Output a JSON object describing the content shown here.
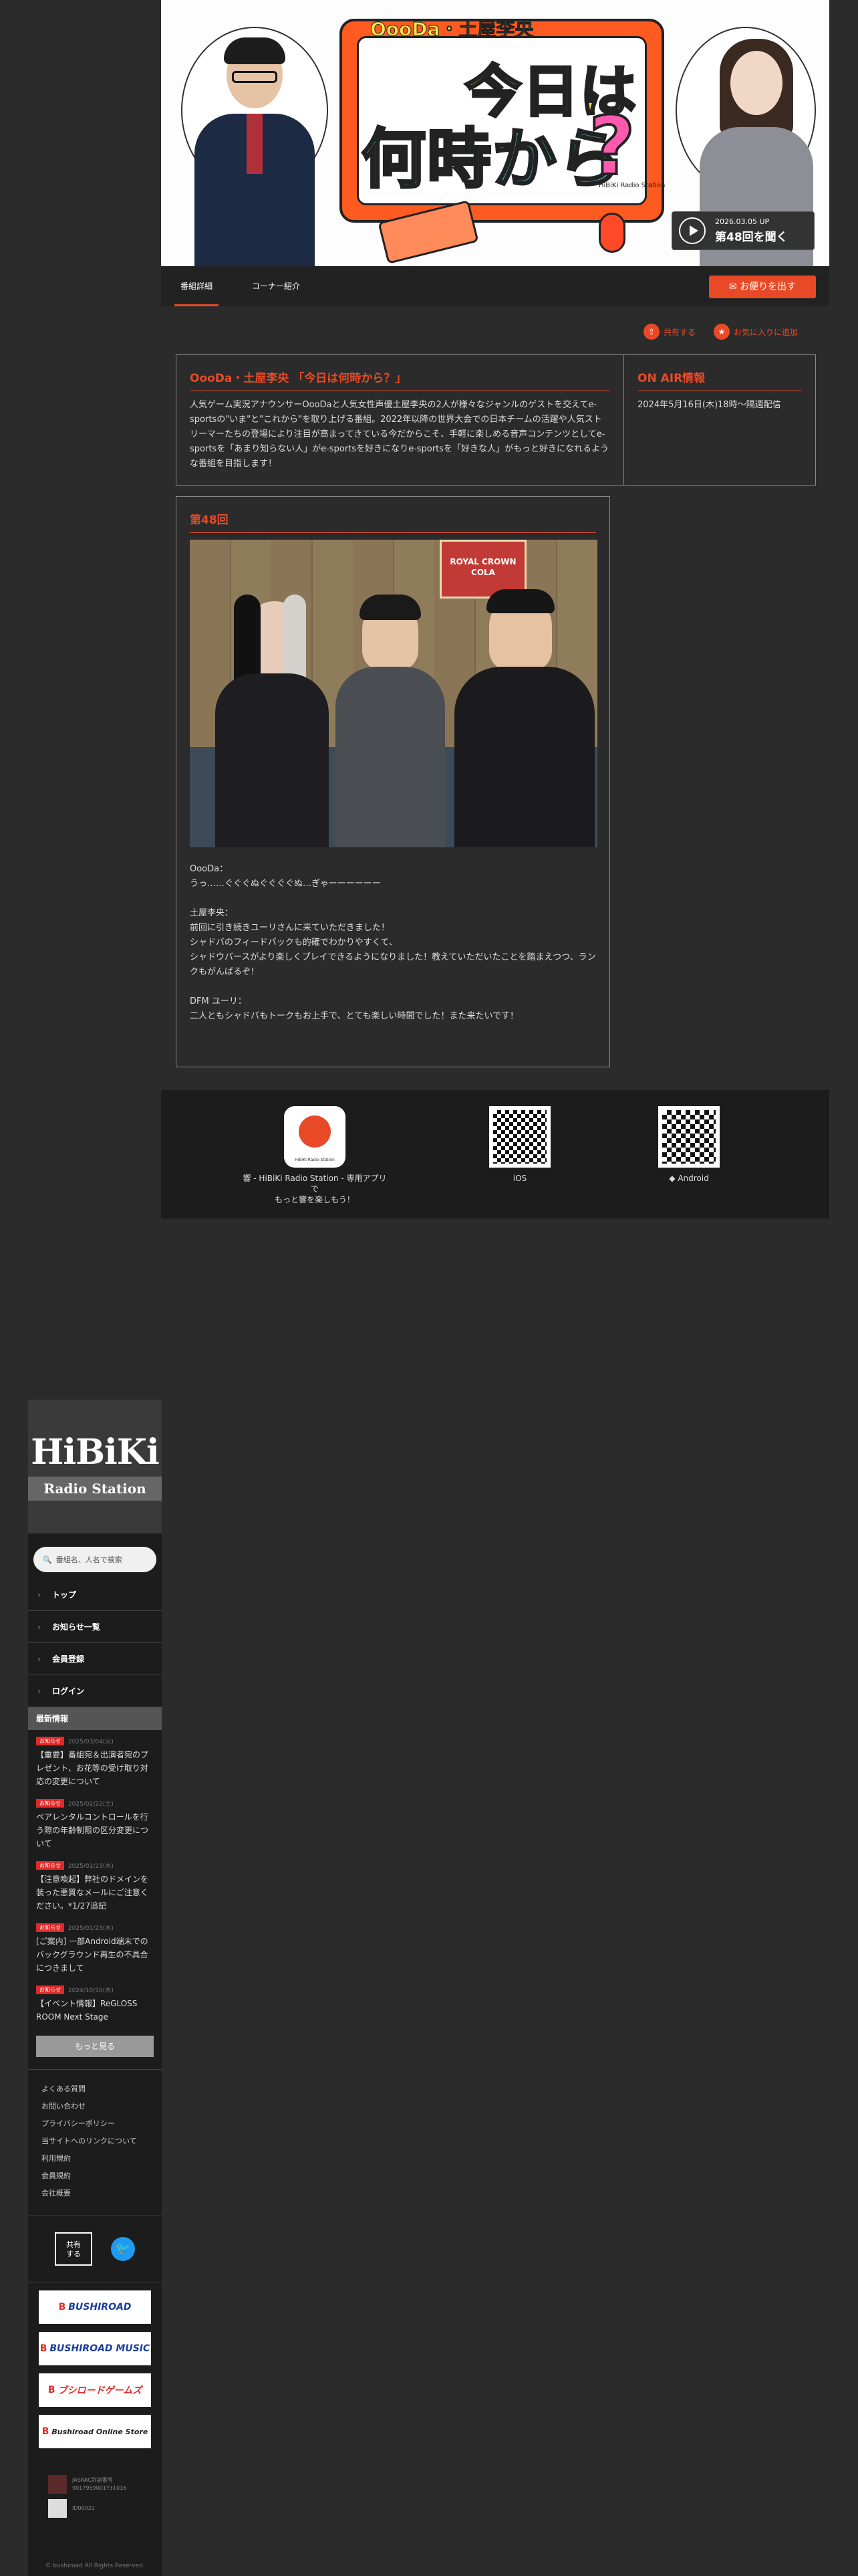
{
  "banner": {
    "sub_title": "OooDa・土屋李央",
    "title_line1": "今日は",
    "title_line2": "何時から",
    "title_mark": "?",
    "brand_mark": "HiBiKi Radio Station",
    "latest_date": "2026.03.05 UP",
    "latest_episode": "第48回を聞く"
  },
  "tabs": [
    {
      "label": "番組詳細"
    },
    {
      "label": "コーナー紹介"
    }
  ],
  "mail_button": "お便りを出す",
  "share": {
    "share_label": "共有する",
    "favorite_label": "お気に入りに追加"
  },
  "program": {
    "title": "OooDa・土屋李央 「今日は何時から？」",
    "description": "人気ゲーム実況アナウンサーOooDaと人気女性声優土屋李央の2人が様々なジャンルのゲストを交えてe-sportsの\"いま\"と\"これから\"を取り上げる番組。2022年以降の世界大会での日本チームの活躍や人気ストリーマーたちの登場により注目が高まってきている今だからこそ、手軽に楽しめる音声コンテンツとしてe-sportsを「あまり知らない人」がe-sportsを好きになりe-sportsを「好きな人」がもっと好きになれるような番組を目指します！"
  },
  "onair": {
    "title": "ON AIR情報",
    "text": "2024年5月16日(木)18時〜隔週配信"
  },
  "episode": {
    "title": "第48回",
    "photo_sign_line1": "ROYAL CROWN",
    "photo_sign_line2": "COLA",
    "paragraphs": [
      [
        "OooDa：",
        "うっ……ぐぐぐぬぐぐぐぐぬ…ぎゃーーーーーー"
      ],
      [
        "土屋李央：",
        "前回に引き続きユーリさんに来ていただきました！",
        "シャドバのフィードバックも的確でわかりやすくて、",
        "シャドウバースがより楽しくプレイできるようになりました！教えていただいたことを踏まえつつ、ランクもがんばるぞ！"
      ],
      [
        "DFM ユーリ：",
        "二人ともシャドバもトークもお上手で、とても楽しい時間でした！また来たいです！"
      ]
    ]
  },
  "apps": {
    "app_icon_label": "HiBiKi Radio Station",
    "app_caption_line1": "響 - HiBiKi Radio Station - 専用アプリで",
    "app_caption_line2": "もっと響を楽しもう！",
    "ios_label": "iOS",
    "android_label": "Android"
  },
  "sidebar": {
    "logo_main": "HiBiKi",
    "logo_sub": "Radio Station",
    "search_placeholder": "番組名、人名で検索",
    "nav": [
      {
        "label": "トップ"
      },
      {
        "label": "お知らせ一覧"
      },
      {
        "label": "会員登録"
      },
      {
        "label": "ログイン"
      }
    ],
    "news_heading": "最新情報",
    "news": [
      {
        "badge": "お知らせ",
        "date": "2025/03/04(火)",
        "title": "【重要】番組宛＆出演者宛のプレゼント、お花等の受け取り対応の変更について"
      },
      {
        "badge": "お知らせ",
        "date": "2025/02/22(土)",
        "title": "ペアレンタルコントロールを行う際の年齢制限の区分変更について"
      },
      {
        "badge": "お知らせ",
        "date": "2025/01/23(木)",
        "title": "【注意喚起】弊社のドメインを装った悪質なメールにご注意ください。*1/27追記"
      },
      {
        "badge": "お知らせ",
        "date": "2025/01/23(木)",
        "title": "[ご案内] 一部Android端末でのバックグラウンド再生の不具合につきまして"
      },
      {
        "badge": "お知らせ",
        "date": "2024/10/10(木)",
        "title": "【イベント情報】ReGLOSS ROOM Next Stage"
      }
    ],
    "more_label": "もっと見る",
    "footer_links": [
      "よくある質問",
      "お問い合わせ",
      "プライバシーポリシー",
      "当サイトへのリンクについて",
      "利用規約",
      "会員規約",
      "会社概要"
    ],
    "share_box_line1": "共有",
    "share_box_line2": "する",
    "twitter_glyph": "🐦",
    "partners": [
      {
        "mark": "B",
        "name": "BUSHIROAD"
      },
      {
        "mark": "B",
        "name": "BUSHIROAD MUSIC"
      },
      {
        "mark": "B",
        "name": "ブシロードゲームズ"
      },
      {
        "mark": "B",
        "name": "Bushiroad Online Store"
      }
    ],
    "license_lines": [
      "JASRAC許諾番号 9017959001Y31016",
      "ID00022"
    ],
    "copyright": "© bushiroad All Rights Reserved."
  },
  "colors": {
    "accent": "#e84a27",
    "background": "#2b2b2b",
    "panel": "#1c1c1c"
  }
}
